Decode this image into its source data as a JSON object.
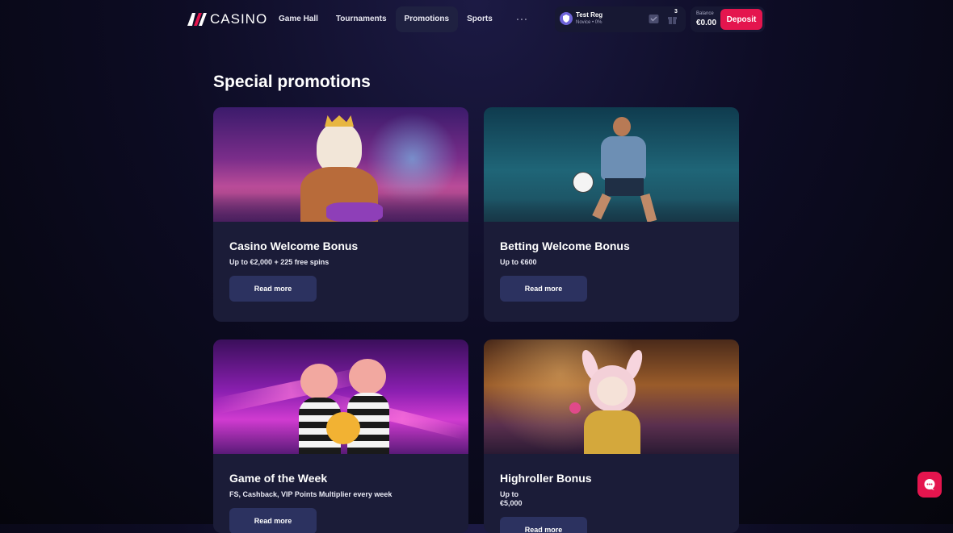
{
  "brand": {
    "name": "CASINO"
  },
  "nav": {
    "items": [
      {
        "label": "Game Hall",
        "active": false
      },
      {
        "label": "Tournaments",
        "active": false
      },
      {
        "label": "Promotions",
        "active": true
      },
      {
        "label": "Sports",
        "active": false
      }
    ],
    "more_label": "···"
  },
  "user": {
    "name": "Test Reg",
    "level": "Novice • 0%",
    "gift_count": "3"
  },
  "balance": {
    "label": "Balance",
    "value": "€0.00"
  },
  "deposit": {
    "label": "Deposit"
  },
  "page": {
    "title": "Special promotions"
  },
  "promotions": [
    {
      "title": "Casino Welcome Bonus",
      "description": "Up to €2,000 + 225 free spins",
      "button": "Read more"
    },
    {
      "title": "Betting Welcome Bonus",
      "description": "Up to €600",
      "button": "Read more"
    },
    {
      "title": "Game of the Week",
      "description": "FS, Cashback, VIP Points Multiplier every week",
      "button": "Read more"
    },
    {
      "title": "Highroller Bonus",
      "description": "Up to\n€5,000",
      "button": "Read more"
    }
  ],
  "colors": {
    "accent": "#e4154e",
    "card_bg": "#1b1c38",
    "button_bg": "#2c3260"
  },
  "icons": [
    "casino-logo-icon",
    "profile-shield-icon",
    "message-icon",
    "gift-icon",
    "chat-icon"
  ]
}
